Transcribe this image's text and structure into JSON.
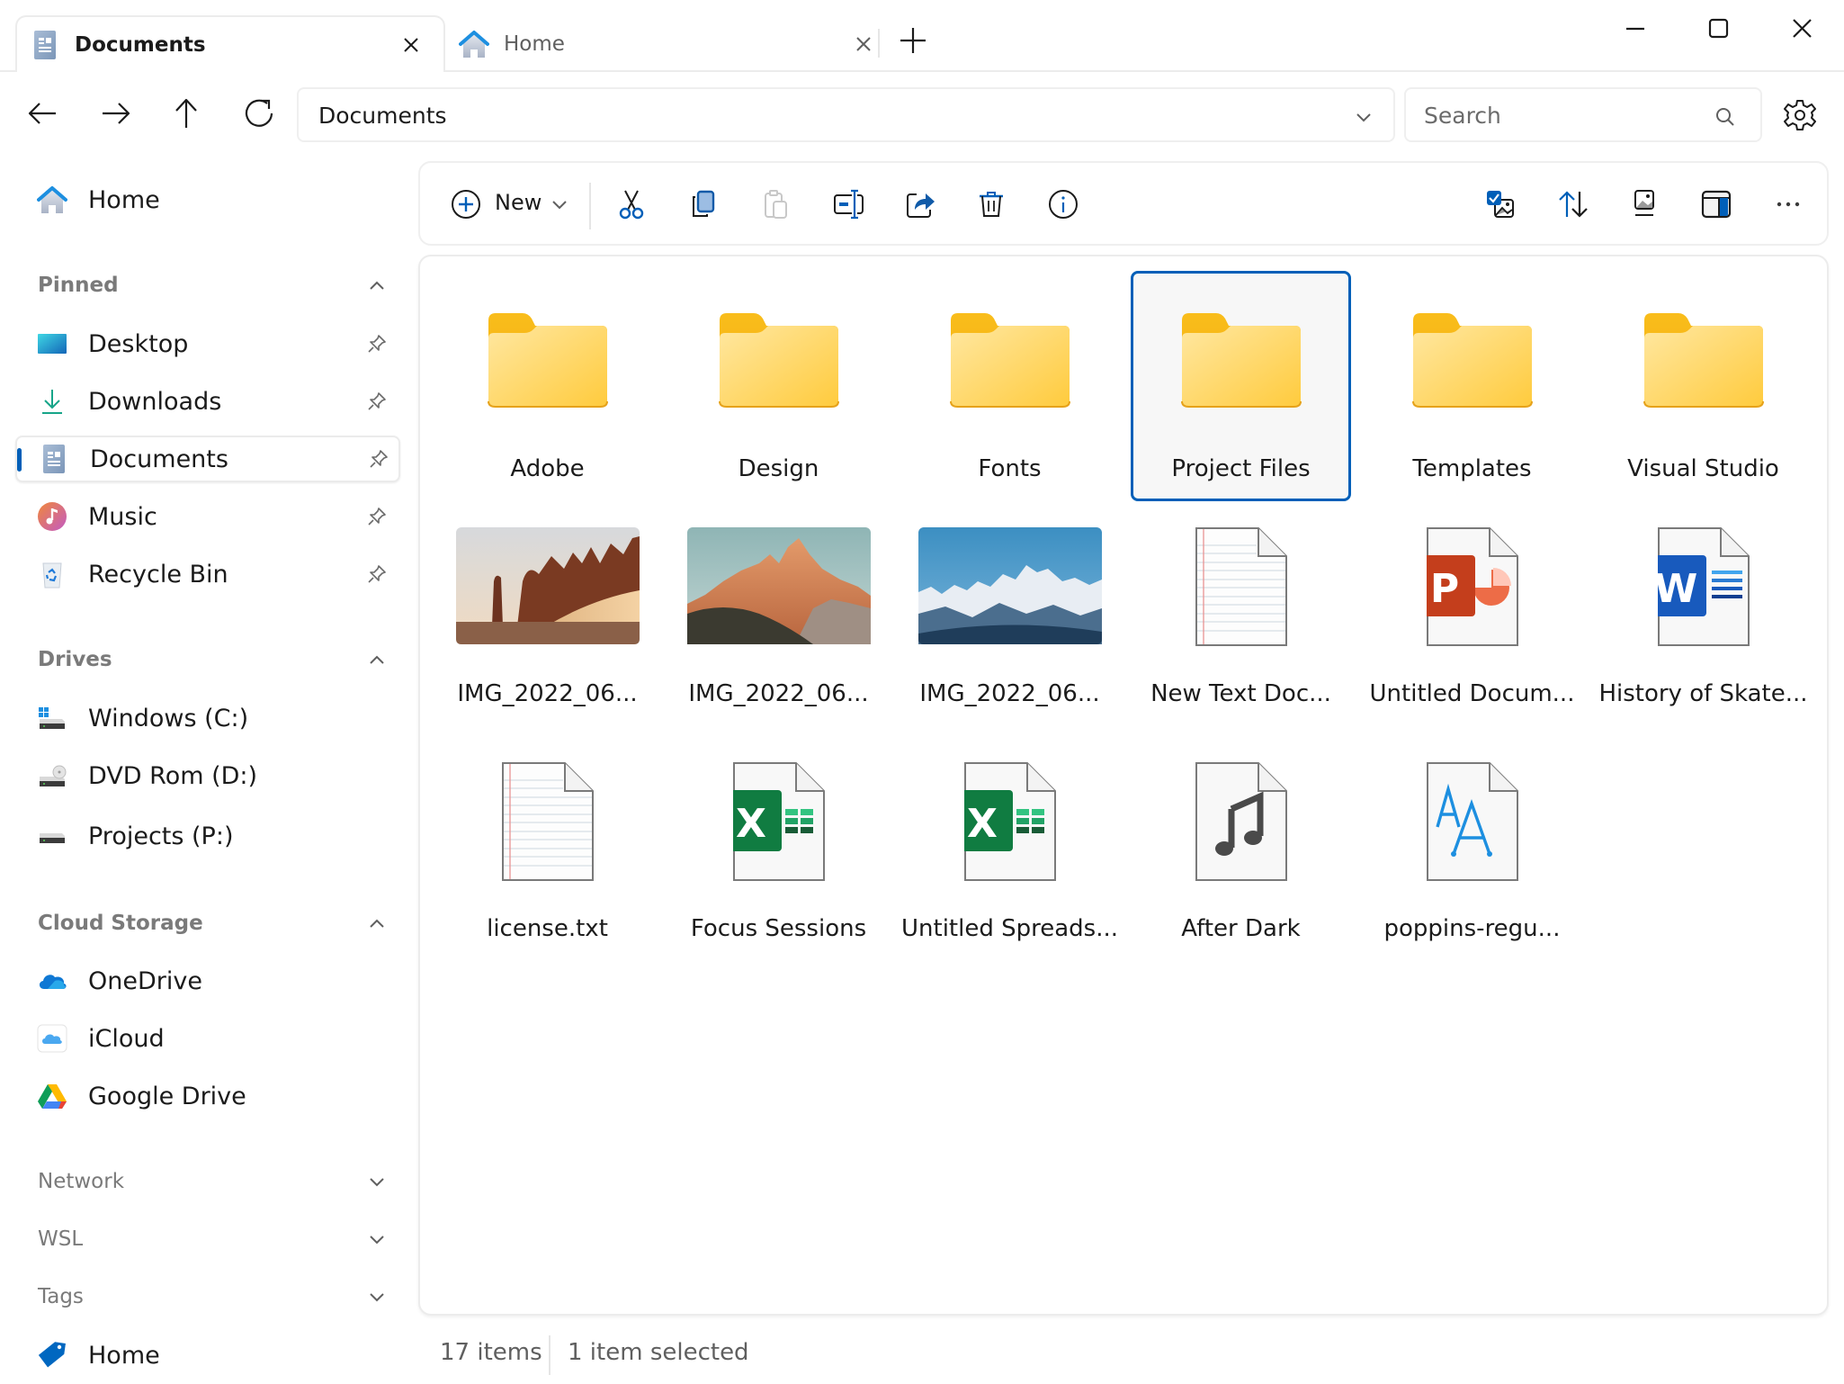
{
  "window": {
    "tabs": [
      {
        "label": "Documents",
        "icon": "documents-icon",
        "active": true
      },
      {
        "label": "Home",
        "icon": "home-icon",
        "active": false
      }
    ],
    "controls": {
      "minimize": "minimize-icon",
      "maximize": "maximize-icon",
      "close": "close-icon"
    }
  },
  "nav": {
    "address": "Documents",
    "search_placeholder": "Search"
  },
  "sidebar": {
    "home": {
      "label": "Home"
    },
    "sections": [
      {
        "title": "Pinned",
        "expanded": true,
        "items": [
          {
            "label": "Desktop",
            "icon": "desktop-icon",
            "pinned": true
          },
          {
            "label": "Downloads",
            "icon": "downloads-icon",
            "pinned": true
          },
          {
            "label": "Documents",
            "icon": "documents-icon",
            "pinned": true,
            "selected": true
          },
          {
            "label": "Music",
            "icon": "music-icon",
            "pinned": true
          },
          {
            "label": "Recycle Bin",
            "icon": "recycle-bin-icon",
            "pinned": true
          }
        ]
      },
      {
        "title": "Drives",
        "expanded": true,
        "items": [
          {
            "label": "Windows (C:)",
            "icon": "windows-drive-icon"
          },
          {
            "label": "DVD Rom (D:)",
            "icon": "dvd-drive-icon"
          },
          {
            "label": "Projects (P:)",
            "icon": "drive-icon"
          }
        ]
      },
      {
        "title": "Cloud Storage",
        "expanded": true,
        "items": [
          {
            "label": "OneDrive",
            "icon": "onedrive-icon"
          },
          {
            "label": "iCloud",
            "icon": "icloud-icon"
          },
          {
            "label": "Google Drive",
            "icon": "google-drive-icon"
          }
        ]
      },
      {
        "title": "Network",
        "expanded": false,
        "items": []
      },
      {
        "title": "WSL",
        "expanded": false,
        "items": []
      },
      {
        "title": "Tags",
        "expanded": false,
        "items": [
          {
            "label": "Home",
            "icon": "tag-icon",
            "color": "#0067c0"
          }
        ]
      }
    ]
  },
  "toolbar": {
    "new_label": "New",
    "actions": [
      "cut",
      "copy",
      "paste",
      "rename",
      "share",
      "delete",
      "properties"
    ],
    "paste_enabled": false,
    "right_actions": [
      "select",
      "sort",
      "view",
      "preview-pane",
      "more"
    ]
  },
  "files": [
    {
      "name": "Adobe",
      "type": "folder"
    },
    {
      "name": "Design",
      "type": "folder"
    },
    {
      "name": "Fonts",
      "type": "folder"
    },
    {
      "name": "Project Files",
      "type": "folder",
      "selected": true
    },
    {
      "name": "Templates",
      "type": "folder"
    },
    {
      "name": "Visual Studio",
      "type": "folder"
    },
    {
      "name": "IMG_2022_06...",
      "type": "image",
      "thumb": "desert-rocks"
    },
    {
      "name": "IMG_2022_06...",
      "type": "image",
      "thumb": "sunlit-peak"
    },
    {
      "name": "IMG_2022_06...",
      "type": "image",
      "thumb": "snowy-range"
    },
    {
      "name": "New Text Doc...",
      "type": "text"
    },
    {
      "name": "Untitled Docum...",
      "type": "powerpoint"
    },
    {
      "name": "History of Skate...",
      "type": "word"
    },
    {
      "name": "license.txt",
      "type": "text"
    },
    {
      "name": "Focus Sessions",
      "type": "excel"
    },
    {
      "name": "Untitled Spreads...",
      "type": "excel"
    },
    {
      "name": "After Dark",
      "type": "audio"
    },
    {
      "name": "poppins-regu...",
      "type": "font"
    }
  ],
  "status": {
    "count": "17 items",
    "selection": "1 item selected"
  },
  "colors": {
    "accent": "#005fb8",
    "folder": "#ffd75e"
  }
}
